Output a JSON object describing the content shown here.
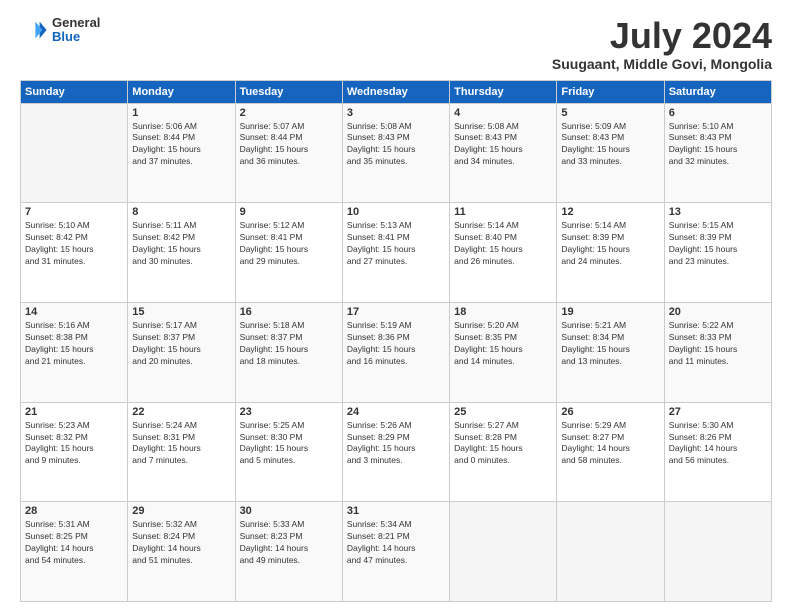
{
  "logo": {
    "general": "General",
    "blue": "Blue"
  },
  "header": {
    "month": "July 2024",
    "location": "Suugaant, Middle Govi, Mongolia"
  },
  "weekdays": [
    "Sunday",
    "Monday",
    "Tuesday",
    "Wednesday",
    "Thursday",
    "Friday",
    "Saturday"
  ],
  "weeks": [
    [
      {
        "day": "",
        "info": ""
      },
      {
        "day": "1",
        "info": "Sunrise: 5:06 AM\nSunset: 8:44 PM\nDaylight: 15 hours\nand 37 minutes."
      },
      {
        "day": "2",
        "info": "Sunrise: 5:07 AM\nSunset: 8:44 PM\nDaylight: 15 hours\nand 36 minutes."
      },
      {
        "day": "3",
        "info": "Sunrise: 5:08 AM\nSunset: 8:43 PM\nDaylight: 15 hours\nand 35 minutes."
      },
      {
        "day": "4",
        "info": "Sunrise: 5:08 AM\nSunset: 8:43 PM\nDaylight: 15 hours\nand 34 minutes."
      },
      {
        "day": "5",
        "info": "Sunrise: 5:09 AM\nSunset: 8:43 PM\nDaylight: 15 hours\nand 33 minutes."
      },
      {
        "day": "6",
        "info": "Sunrise: 5:10 AM\nSunset: 8:43 PM\nDaylight: 15 hours\nand 32 minutes."
      }
    ],
    [
      {
        "day": "7",
        "info": "Sunrise: 5:10 AM\nSunset: 8:42 PM\nDaylight: 15 hours\nand 31 minutes."
      },
      {
        "day": "8",
        "info": "Sunrise: 5:11 AM\nSunset: 8:42 PM\nDaylight: 15 hours\nand 30 minutes."
      },
      {
        "day": "9",
        "info": "Sunrise: 5:12 AM\nSunset: 8:41 PM\nDaylight: 15 hours\nand 29 minutes."
      },
      {
        "day": "10",
        "info": "Sunrise: 5:13 AM\nSunset: 8:41 PM\nDaylight: 15 hours\nand 27 minutes."
      },
      {
        "day": "11",
        "info": "Sunrise: 5:14 AM\nSunset: 8:40 PM\nDaylight: 15 hours\nand 26 minutes."
      },
      {
        "day": "12",
        "info": "Sunrise: 5:14 AM\nSunset: 8:39 PM\nDaylight: 15 hours\nand 24 minutes."
      },
      {
        "day": "13",
        "info": "Sunrise: 5:15 AM\nSunset: 8:39 PM\nDaylight: 15 hours\nand 23 minutes."
      }
    ],
    [
      {
        "day": "14",
        "info": "Sunrise: 5:16 AM\nSunset: 8:38 PM\nDaylight: 15 hours\nand 21 minutes."
      },
      {
        "day": "15",
        "info": "Sunrise: 5:17 AM\nSunset: 8:37 PM\nDaylight: 15 hours\nand 20 minutes."
      },
      {
        "day": "16",
        "info": "Sunrise: 5:18 AM\nSunset: 8:37 PM\nDaylight: 15 hours\nand 18 minutes."
      },
      {
        "day": "17",
        "info": "Sunrise: 5:19 AM\nSunset: 8:36 PM\nDaylight: 15 hours\nand 16 minutes."
      },
      {
        "day": "18",
        "info": "Sunrise: 5:20 AM\nSunset: 8:35 PM\nDaylight: 15 hours\nand 14 minutes."
      },
      {
        "day": "19",
        "info": "Sunrise: 5:21 AM\nSunset: 8:34 PM\nDaylight: 15 hours\nand 13 minutes."
      },
      {
        "day": "20",
        "info": "Sunrise: 5:22 AM\nSunset: 8:33 PM\nDaylight: 15 hours\nand 11 minutes."
      }
    ],
    [
      {
        "day": "21",
        "info": "Sunrise: 5:23 AM\nSunset: 8:32 PM\nDaylight: 15 hours\nand 9 minutes."
      },
      {
        "day": "22",
        "info": "Sunrise: 5:24 AM\nSunset: 8:31 PM\nDaylight: 15 hours\nand 7 minutes."
      },
      {
        "day": "23",
        "info": "Sunrise: 5:25 AM\nSunset: 8:30 PM\nDaylight: 15 hours\nand 5 minutes."
      },
      {
        "day": "24",
        "info": "Sunrise: 5:26 AM\nSunset: 8:29 PM\nDaylight: 15 hours\nand 3 minutes."
      },
      {
        "day": "25",
        "info": "Sunrise: 5:27 AM\nSunset: 8:28 PM\nDaylight: 15 hours\nand 0 minutes."
      },
      {
        "day": "26",
        "info": "Sunrise: 5:29 AM\nSunset: 8:27 PM\nDaylight: 14 hours\nand 58 minutes."
      },
      {
        "day": "27",
        "info": "Sunrise: 5:30 AM\nSunset: 8:26 PM\nDaylight: 14 hours\nand 56 minutes."
      }
    ],
    [
      {
        "day": "28",
        "info": "Sunrise: 5:31 AM\nSunset: 8:25 PM\nDaylight: 14 hours\nand 54 minutes."
      },
      {
        "day": "29",
        "info": "Sunrise: 5:32 AM\nSunset: 8:24 PM\nDaylight: 14 hours\nand 51 minutes."
      },
      {
        "day": "30",
        "info": "Sunrise: 5:33 AM\nSunset: 8:23 PM\nDaylight: 14 hours\nand 49 minutes."
      },
      {
        "day": "31",
        "info": "Sunrise: 5:34 AM\nSunset: 8:21 PM\nDaylight: 14 hours\nand 47 minutes."
      },
      {
        "day": "",
        "info": ""
      },
      {
        "day": "",
        "info": ""
      },
      {
        "day": "",
        "info": ""
      }
    ]
  ]
}
